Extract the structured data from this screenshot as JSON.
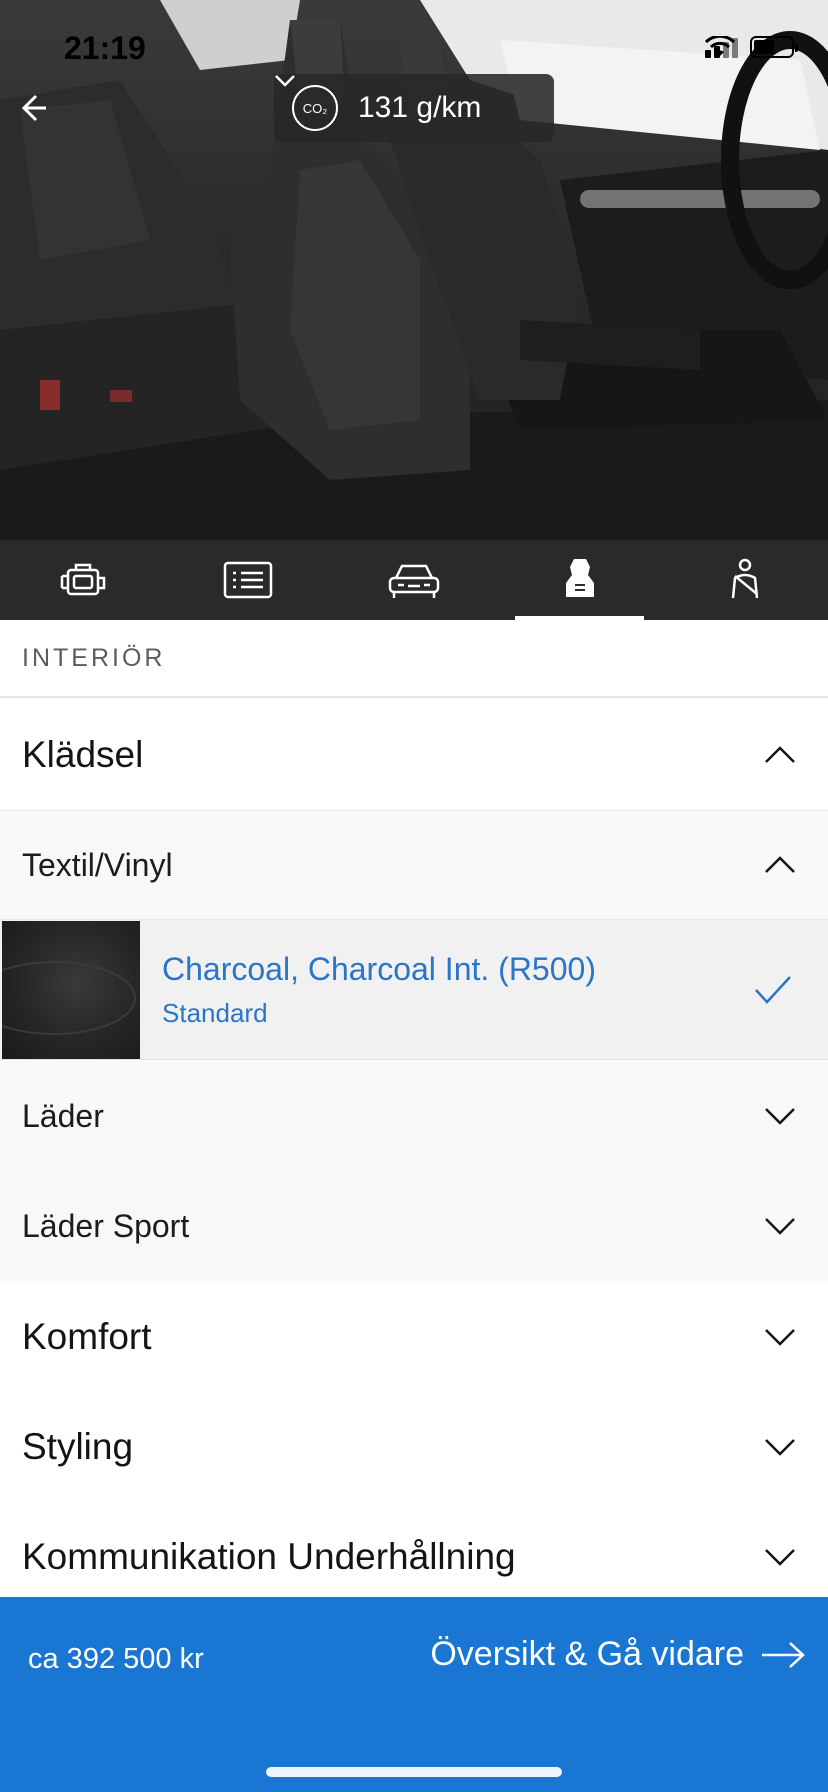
{
  "status_bar": {
    "time": "21:19"
  },
  "header": {
    "co2_icon_text": "CO₂",
    "co2_value": "131 g/km"
  },
  "tabs": [
    {
      "icon": "engine-icon",
      "active": false
    },
    {
      "icon": "list-icon",
      "active": false
    },
    {
      "icon": "car-front-icon",
      "active": false
    },
    {
      "icon": "seat-icon",
      "active": true
    },
    {
      "icon": "seatbelt-icon",
      "active": false
    }
  ],
  "section": {
    "title": "INTERIÖR"
  },
  "categories": {
    "upholstery": "Klädsel",
    "comfort": "Komfort",
    "styling": "Styling",
    "communication": "Kommunikation Underhållning"
  },
  "subcategories": {
    "textile_vinyl": "Textil/Vinyl",
    "leather": "Läder",
    "leather_sport": "Läder Sport"
  },
  "selected_option": {
    "name": "Charcoal, Charcoal Int. (R500)",
    "tag": "Standard"
  },
  "footer": {
    "price": "ca 392 500 kr",
    "cta_label": "Översikt & Gå vidare"
  },
  "colors": {
    "accent": "#1976d2",
    "selected_text": "#2a75c8",
    "tabbar_bg": "#2a2a2a"
  }
}
